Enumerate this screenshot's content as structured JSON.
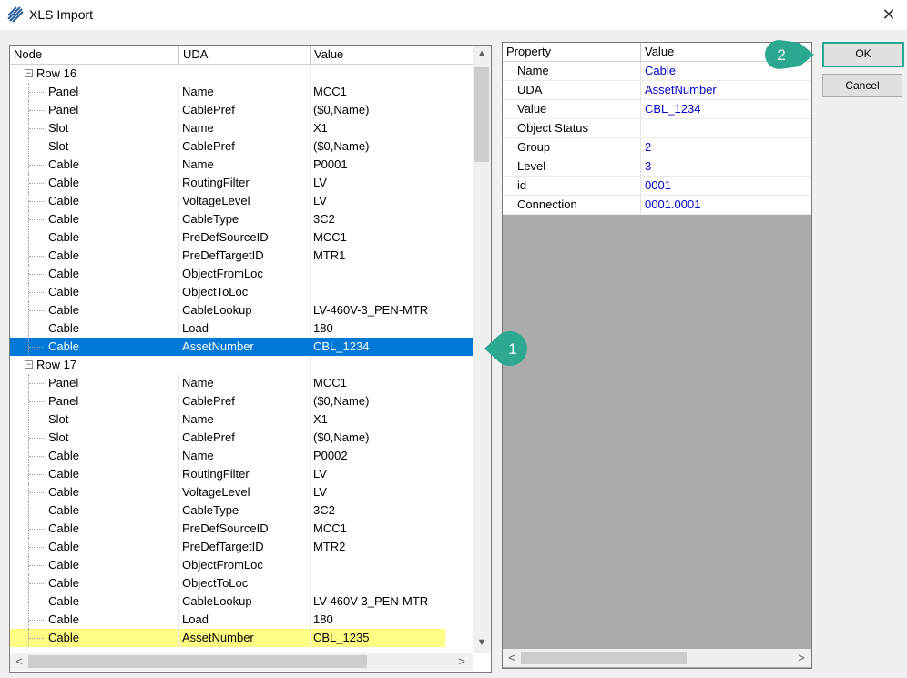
{
  "window": {
    "title": "XLS Import",
    "close_glyph": "✕"
  },
  "colors": {
    "accent_selected": "#0078d7",
    "highlight": "#fffe85",
    "callout": "#2ba88f",
    "value_text": "#0000cc"
  },
  "grid": {
    "columns": [
      "Node",
      "UDA",
      "Value"
    ],
    "groups": [
      {
        "label": "Row 16",
        "rows": [
          [
            "Panel",
            "Name",
            "MCC1"
          ],
          [
            "Panel",
            "CablePref",
            "($0,Name)"
          ],
          [
            "Slot",
            "Name",
            "X1"
          ],
          [
            "Slot",
            "CablePref",
            "($0,Name)"
          ],
          [
            "Cable",
            "Name",
            "P0001"
          ],
          [
            "Cable",
            "RoutingFilter",
            "LV"
          ],
          [
            "Cable",
            "VoltageLevel",
            "LV"
          ],
          [
            "Cable",
            "CableType",
            "3C2"
          ],
          [
            "Cable",
            "PreDefSourceID",
            "MCC1"
          ],
          [
            "Cable",
            "PreDefTargetID",
            "MTR1"
          ],
          [
            "Cable",
            "ObjectFromLoc",
            ""
          ],
          [
            "Cable",
            "ObjectToLoc",
            ""
          ],
          [
            "Cable",
            "CableLookup",
            "LV-460V-3_PEN-MTR"
          ],
          [
            "Cable",
            "Load",
            "180"
          ],
          [
            "Cable",
            "AssetNumber",
            "CBL_1234"
          ]
        ]
      },
      {
        "label": "Row 17",
        "rows": [
          [
            "Panel",
            "Name",
            "MCC1"
          ],
          [
            "Panel",
            "CablePref",
            "($0,Name)"
          ],
          [
            "Slot",
            "Name",
            "X1"
          ],
          [
            "Slot",
            "CablePref",
            "($0,Name)"
          ],
          [
            "Cable",
            "Name",
            "P0002"
          ],
          [
            "Cable",
            "RoutingFilter",
            "LV"
          ],
          [
            "Cable",
            "VoltageLevel",
            "LV"
          ],
          [
            "Cable",
            "CableType",
            "3C2"
          ],
          [
            "Cable",
            "PreDefSourceID",
            "MCC1"
          ],
          [
            "Cable",
            "PreDefTargetID",
            "MTR2"
          ],
          [
            "Cable",
            "ObjectFromLoc",
            ""
          ],
          [
            "Cable",
            "ObjectToLoc",
            ""
          ],
          [
            "Cable",
            "CableLookup",
            "LV-460V-3_PEN-MTR"
          ],
          [
            "Cable",
            "Load",
            "180"
          ],
          [
            "Cable",
            "AssetNumber",
            "CBL_1235"
          ]
        ]
      }
    ]
  },
  "properties": {
    "columns": [
      "Property",
      "Value"
    ],
    "rows": [
      [
        "Name",
        "Cable"
      ],
      [
        "UDA",
        "AssetNumber"
      ],
      [
        "Value",
        "CBL_1234"
      ],
      [
        "Object Status",
        ""
      ],
      [
        "Group",
        "2"
      ],
      [
        "Level",
        "3"
      ],
      [
        "id",
        "0001"
      ],
      [
        "Connection",
        "0001.0001"
      ]
    ]
  },
  "buttons": {
    "ok": "OK",
    "cancel": "Cancel"
  },
  "callouts": {
    "one": "1",
    "two": "2"
  },
  "scroll_glyphs": {
    "up": "▲",
    "down": "▼",
    "left": "<",
    "right": ">"
  }
}
